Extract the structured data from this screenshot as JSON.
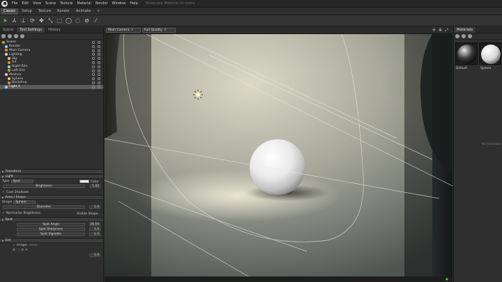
{
  "menubar": {
    "items": [
      "File",
      "Edit",
      "View",
      "Scene",
      "Texture",
      "Material",
      "Render",
      "Window",
      "Help"
    ],
    "doc_title": "Showcase Material Lit.scene"
  },
  "modes": [
    "Classic",
    "Setup",
    "Texture",
    "Render",
    "Animate",
    "+"
  ],
  "toolbar": {
    "icons": [
      "select-arrow-icon",
      "bone-icon",
      "move-gizmo-icon",
      "rotate-gizmo-icon",
      "grab-icon",
      "scale-gizmo-icon",
      "marquee-select-icon",
      "lasso-circle-icon",
      "lasso-freeform-icon",
      "paint-select-icon",
      "magic-wand-icon"
    ]
  },
  "left_panel": {
    "tabs": [
      "Scene",
      "Tool Settings",
      "History"
    ],
    "tree": [
      {
        "label": "Scene",
        "indent": 0
      },
      {
        "label": "Render",
        "indent": 1
      },
      {
        "label": "Main Camera",
        "indent": 1
      },
      {
        "label": "Lighting",
        "indent": 1
      },
      {
        "label": "Sky",
        "indent": 2
      },
      {
        "label": "Fill",
        "indent": 2
      },
      {
        "label": "Right Rim",
        "indent": 2
      },
      {
        "label": "Left Rim",
        "indent": 2
      },
      {
        "label": "Meshes",
        "indent": 1
      },
      {
        "label": "Sphere",
        "indent": 2
      },
      {
        "label": "Backdrop",
        "indent": 2
      },
      {
        "label": "Light 1",
        "indent": 1
      }
    ],
    "selected_index": 11,
    "sections": {
      "transform": "Transform",
      "light": "Light",
      "area_shape": "Area / Shape",
      "spot": "Spot",
      "gel": "Gel"
    },
    "light": {
      "type_label": "Type",
      "type_value": "Spot",
      "color_label": "Color",
      "brightness_label": "Brightness",
      "brightness_value": "1.82",
      "cast_shadows": "Cast Shadows"
    },
    "area_shape": {
      "shape_label": "Shape",
      "shape_value": "Sphere",
      "diameter_label": "Diameter",
      "diameter_value": "1.0",
      "normalize_brightness": "Normalize Brightness",
      "visible_shape": "Visible Shape"
    },
    "spot": {
      "angle_label": "Spot Angle",
      "angle_value": "26.19",
      "sharpness_label": "Spot Sharpness",
      "sharpness_value": "1.0",
      "vignette_label": "Spot Vignette",
      "vignette_value": "1.0"
    },
    "gel": {
      "image_label": "Image:",
      "image_value": "none",
      "tile_value": "1.0"
    }
  },
  "viewport": {
    "camera": "Main Camera",
    "quality": "Full Quality",
    "header_icons": [
      "crosshair-icon",
      "settings-icon",
      "maximize-icon"
    ]
  },
  "right_panel": {
    "tab": "Materials",
    "materials": [
      "Default",
      "Sphere"
    ],
    "empty_text": "No Selection"
  },
  "colors": {
    "accent_green": "#59c34a",
    "selection": "#5a5a5a",
    "backdrop": "#d8d8c4"
  }
}
